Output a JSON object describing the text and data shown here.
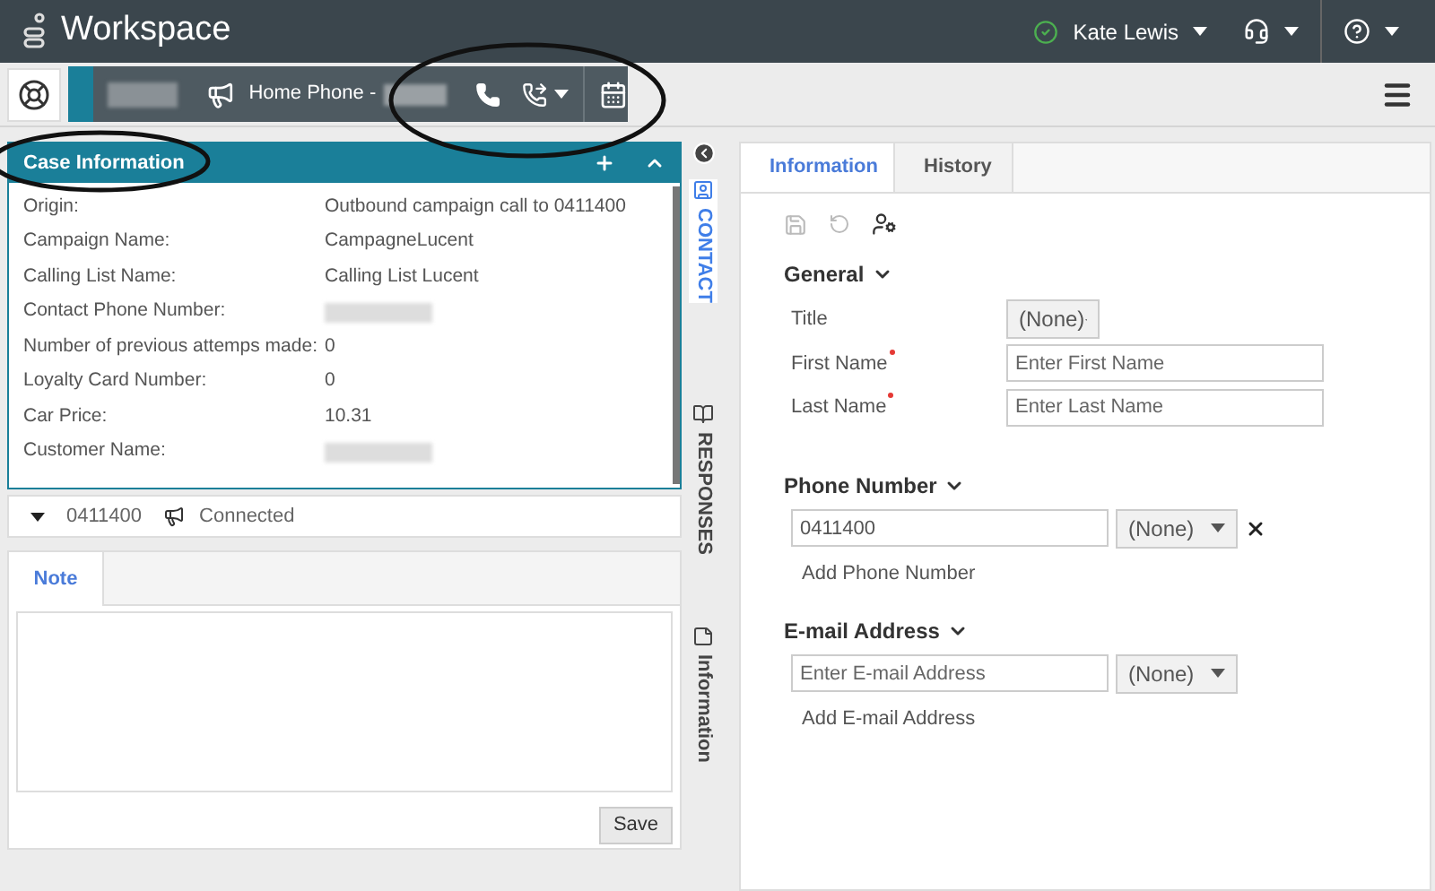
{
  "header": {
    "app_title": "Workspace",
    "user_name": "Kate Lewis"
  },
  "interaction_bar": {
    "caller_label": "Home Phone -"
  },
  "case_info": {
    "title": "Case Information",
    "fields": [
      {
        "label": "Origin:",
        "kind": "text",
        "value": "Outbound campaign call to 0411400"
      },
      {
        "label": "Campaign Name:",
        "kind": "text",
        "value": "CampagneLucent"
      },
      {
        "label": "Calling List Name:",
        "kind": "text",
        "value": "Calling List Lucent"
      },
      {
        "label": "Contact Phone Number:",
        "kind": "redacted"
      },
      {
        "label": "Number of previous attemps made:",
        "kind": "text",
        "value": "0"
      },
      {
        "label": "Loyalty Card Number:",
        "kind": "text",
        "value": "0"
      },
      {
        "label": "Car Price:",
        "kind": "text",
        "value": "10.31"
      },
      {
        "label": "Customer Name:",
        "kind": "redacted"
      }
    ]
  },
  "call_status": {
    "number": "0411400",
    "status": "Connected"
  },
  "note": {
    "tabs": [
      {
        "label": "Note",
        "selected": true
      }
    ],
    "save_label": "Save"
  },
  "side_tabs": [
    {
      "label": "CONTACT",
      "selected": true
    },
    {
      "label": "RESPONSES",
      "selected": false
    },
    {
      "label": "Information",
      "selected": false
    }
  ],
  "contact": {
    "tabs": [
      {
        "label": "Information",
        "selected": true
      },
      {
        "label": "History",
        "selected": false
      }
    ],
    "general": {
      "title": "General",
      "fields": [
        {
          "label": "Title",
          "required": false,
          "kind": "select",
          "value": "(None)"
        },
        {
          "label": "First Name",
          "required": true,
          "kind": "input",
          "placeholder": "Enter First Name"
        },
        {
          "label": "Last Name",
          "required": true,
          "kind": "input",
          "placeholder": "Enter Last Name"
        }
      ]
    },
    "phone": {
      "title": "Phone Number",
      "entries": [
        {
          "value": "0411400",
          "type": "(None)",
          "removable": true
        }
      ],
      "add_label": "Add Phone Number"
    },
    "email": {
      "title": "E-mail Address",
      "entries": [
        {
          "placeholder": "Enter E-mail Address",
          "type": "(None)",
          "removable": false
        }
      ],
      "add_label": "Add E-mail Address"
    }
  }
}
